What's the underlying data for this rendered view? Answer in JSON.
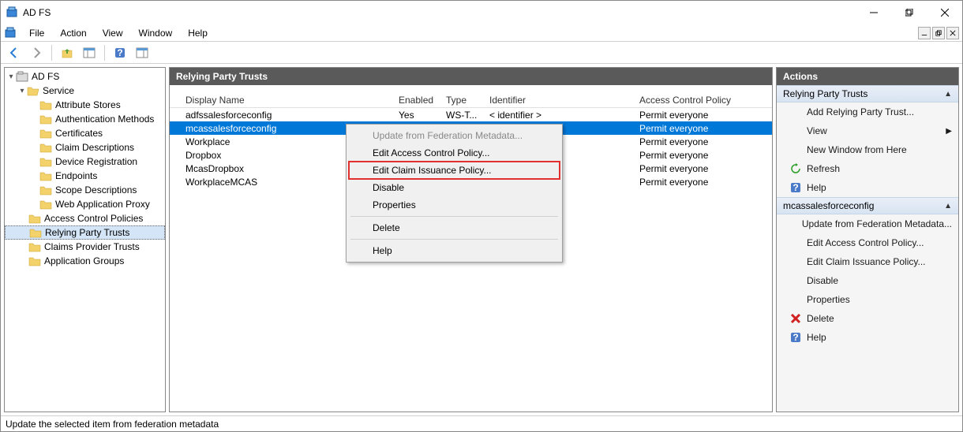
{
  "window": {
    "title": "AD FS"
  },
  "menu": {
    "file": "File",
    "action": "Action",
    "view": "View",
    "window": "Window",
    "help": "Help"
  },
  "tree": {
    "root": "AD FS",
    "service": "Service",
    "items": [
      "Attribute Stores",
      "Authentication Methods",
      "Certificates",
      "Claim Descriptions",
      "Device Registration",
      "Endpoints",
      "Scope Descriptions",
      "Web Application Proxy"
    ],
    "acp": "Access Control Policies",
    "rpt": "Relying Party Trusts",
    "cpt": "Claims Provider Trusts",
    "ag": "Application Groups"
  },
  "center": {
    "title": "Relying Party Trusts",
    "cols": {
      "name": "Display Name",
      "enabled": "Enabled",
      "type": "Type",
      "id": "Identifier",
      "acp": "Access Control Policy"
    },
    "rows": [
      {
        "name": "adfssalesforceconfig",
        "enabled": "Yes",
        "type": "WS-T...",
        "id": "< identifier >",
        "acp": "Permit everyone"
      },
      {
        "name": "mcassalesforceconfig",
        "enabled": "",
        "type": "",
        "id": "",
        "acp": "Permit everyone"
      },
      {
        "name": "Workplace",
        "enabled": "",
        "type": "",
        "id": "",
        "acp": "Permit everyone"
      },
      {
        "name": "Dropbox",
        "enabled": "",
        "type": "",
        "id": "",
        "acp": "Permit everyone"
      },
      {
        "name": "McasDropbox",
        "enabled": "",
        "type": "",
        "id": "",
        "acp": "Permit everyone"
      },
      {
        "name": "WorkplaceMCAS",
        "enabled": "",
        "type": "",
        "id": "",
        "acp": "Permit everyone"
      }
    ]
  },
  "context": {
    "update": "Update from Federation Metadata...",
    "eacp": "Edit Access Control Policy...",
    "ecip": "Edit Claim Issuance Policy...",
    "disable": "Disable",
    "properties": "Properties",
    "delete": "Delete",
    "help": "Help"
  },
  "actions": {
    "title": "Actions",
    "group1": "Relying Party Trusts",
    "g1_add": "Add Relying Party Trust...",
    "g1_view": "View",
    "g1_new": "New Window from Here",
    "g1_refresh": "Refresh",
    "g1_help": "Help",
    "group2": "mcassalesforceconfig",
    "g2_update": "Update from Federation Metadata...",
    "g2_eacp": "Edit Access Control Policy...",
    "g2_ecip": "Edit Claim Issuance Policy...",
    "g2_disable": "Disable",
    "g2_props": "Properties",
    "g2_delete": "Delete",
    "g2_help": "Help"
  },
  "status": "Update the selected item from federation metadata"
}
